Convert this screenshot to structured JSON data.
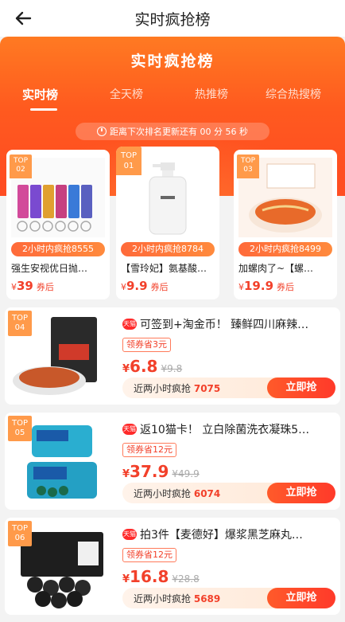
{
  "nav": {
    "title": "实时疯抢榜",
    "back_icon": "arrow-left-icon"
  },
  "hero": {
    "title": "实时疯抢榜",
    "tabs": [
      "实时榜",
      "全天榜",
      "热推榜",
      "综合热搜榜"
    ],
    "active_tab": "实时榜",
    "countdown": "距离下次排名更新还有 00 分 56 秒",
    "colors": {
      "accent": "#ff5a1f",
      "price": "#f2402a"
    }
  },
  "top3": [
    {
      "rank_label": "TOP",
      "rank": "02",
      "hot": "2小时内疯抢8555",
      "name": "强生安视优日抛…",
      "price": "39",
      "after": "券后"
    },
    {
      "rank_label": "TOP",
      "rank": "01",
      "hot": "2小时内疯抢8784",
      "name": "【雪玲妃】氨基酸…",
      "price": "9.9",
      "after": "券后"
    },
    {
      "rank_label": "TOP",
      "rank": "03",
      "hot": "2小时内疯抢8499",
      "name": "加螺肉了~【螺…",
      "price": "19.9",
      "after": "券后"
    }
  ],
  "items": [
    {
      "rank_label": "TOP",
      "rank": "04",
      "badge": "天猫",
      "name": "可签到+淘金币！ 臻鲜四川麻辣…",
      "coupon": "领券省3元",
      "price": "6.8",
      "old_price": "¥9.8",
      "hot_label": "近两小时疯抢",
      "hot_count": "7075",
      "buy": "立即抢"
    },
    {
      "rank_label": "TOP",
      "rank": "05",
      "badge": "天猫",
      "name": "返10猫卡！ 立白除菌洗衣凝珠5…",
      "coupon": "领券省12元",
      "price": "37.9",
      "old_price": "¥49.9",
      "hot_label": "近两小时疯抢",
      "hot_count": "6074",
      "buy": "立即抢"
    },
    {
      "rank_label": "TOP",
      "rank": "06",
      "badge": "天猫",
      "name": "拍3件【麦德好】爆浆黑芝麻丸…",
      "coupon": "领券省12元",
      "price": "16.8",
      "old_price": "¥28.8",
      "hot_label": "近两小时疯抢",
      "hot_count": "5689",
      "buy": "立即抢"
    }
  ]
}
